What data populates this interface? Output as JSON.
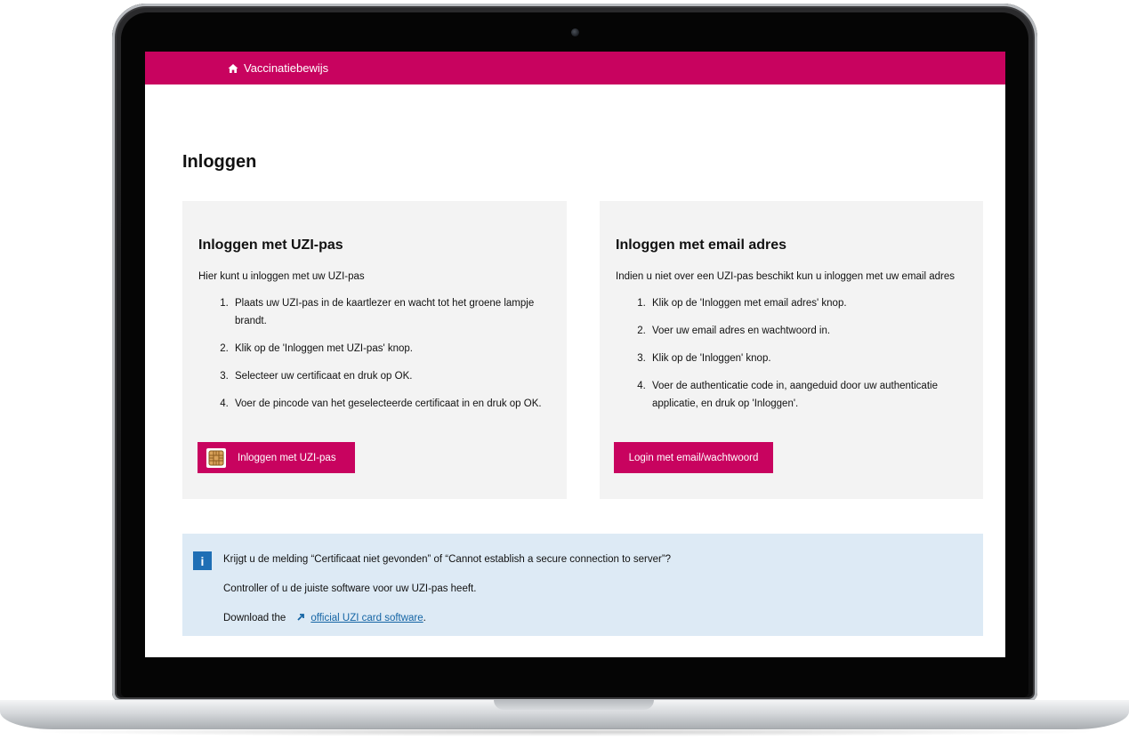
{
  "header": {
    "home_label": "Vaccinatiebewijs",
    "home_icon": "home-icon",
    "brand_color": "#c8035f"
  },
  "page": {
    "title": "Inloggen"
  },
  "uzi_card": {
    "title": "Inloggen met UZI-pas",
    "intro": "Hier kunt u inloggen met uw UZI-pas",
    "steps": [
      "Plaats uw UZI-pas in de kaartlezer en wacht tot het groene lampje brandt.",
      "Klik op de 'Inloggen met UZI-pas' knop.",
      "Selecteer uw certificaat en druk op OK.",
      "Voer de pincode van het geselecteerde certificaat in en druk op OK."
    ],
    "button_label": "Inloggen met UZI-pas",
    "button_icon": "smartcard-chip-icon"
  },
  "email_card": {
    "title": "Inloggen met email adres",
    "intro": "Indien u niet over een UZI-pas beschikt kun u inloggen met uw email adres",
    "steps": [
      "Klik op de 'Inloggen met email adres' knop.",
      "Voer uw email adres en wachtwoord in.",
      "Klik op de 'Inloggen' knop.",
      "Voer de authenticatie code in, aangeduid door uw authenticatie applicatie, en druk op 'Inloggen'."
    ],
    "button_label": "Login met email/wachtwoord"
  },
  "info_box": {
    "icon": "info-icon",
    "icon_glyph": "i",
    "line1": "Krijgt u de melding “Certificaat niet gevonden” of “Cannot establish a secure connection to server”?",
    "line2": "Controller of u de juiste software voor uw UZI-pas heeft.",
    "line3_prefix": "Download the",
    "link_text": "official UZI card software",
    "line3_suffix": ".",
    "background_color": "#ddeaf5"
  }
}
